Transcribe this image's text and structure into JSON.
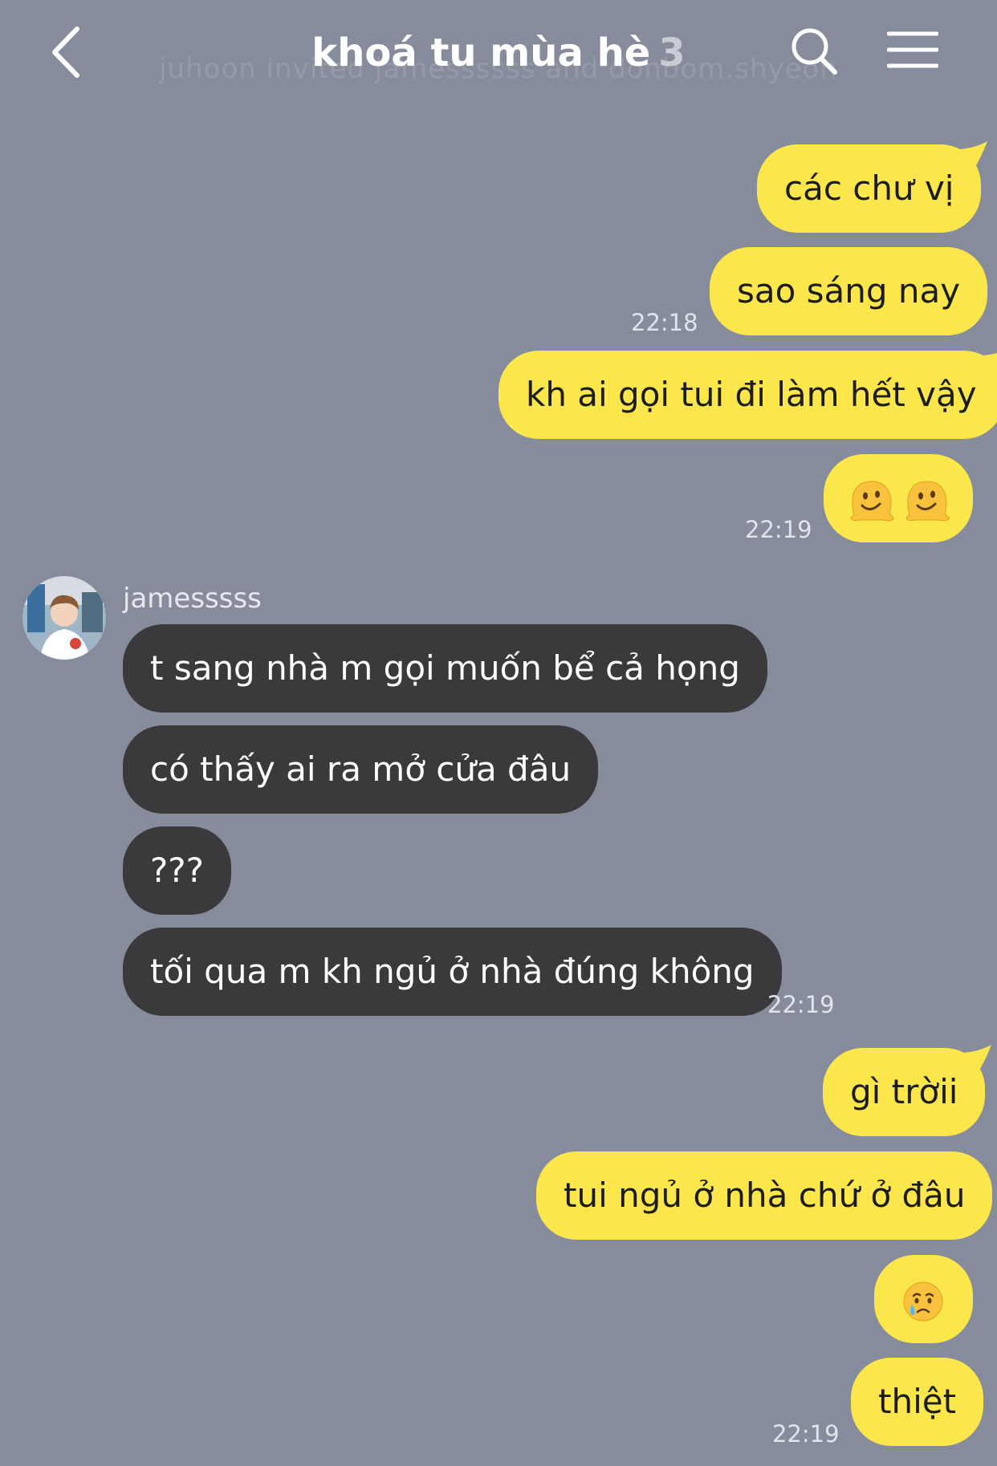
{
  "header": {
    "title": "khoá tu mùa hè",
    "member_count": "3",
    "ghost_text": "juhoon invited jamessssss and donbom.shyeon"
  },
  "icons": {
    "back": "chevron-left-icon",
    "search": "search-icon",
    "menu": "hamburger-menu-icon",
    "melting_face": "melting-face-emoji",
    "crying_face": "crying-face-emoji"
  },
  "colors": {
    "background": "#868c9c",
    "my_bubble": "#fbe74c",
    "their_bubble": "#3a3a3c"
  },
  "messages": {
    "m1": "các chư vị",
    "m2": "sao sáng nay",
    "t1": "22:18",
    "m3": "kh ai gọi tui đi làm hết vậy",
    "t2": "22:19",
    "sender": "jamesssss",
    "r1": "t sang nhà m gọi muốn bể cả họng",
    "r2": "có thấy ai ra mở cửa đâu",
    "r3": "???",
    "r4": "tối qua m kh ngủ ở nhà đúng không",
    "t3": "22:19",
    "m5": "gì trờii",
    "m6": "tui ngủ ở nhà chứ ở đâu",
    "m8": "thiệt",
    "t4": "22:19"
  }
}
